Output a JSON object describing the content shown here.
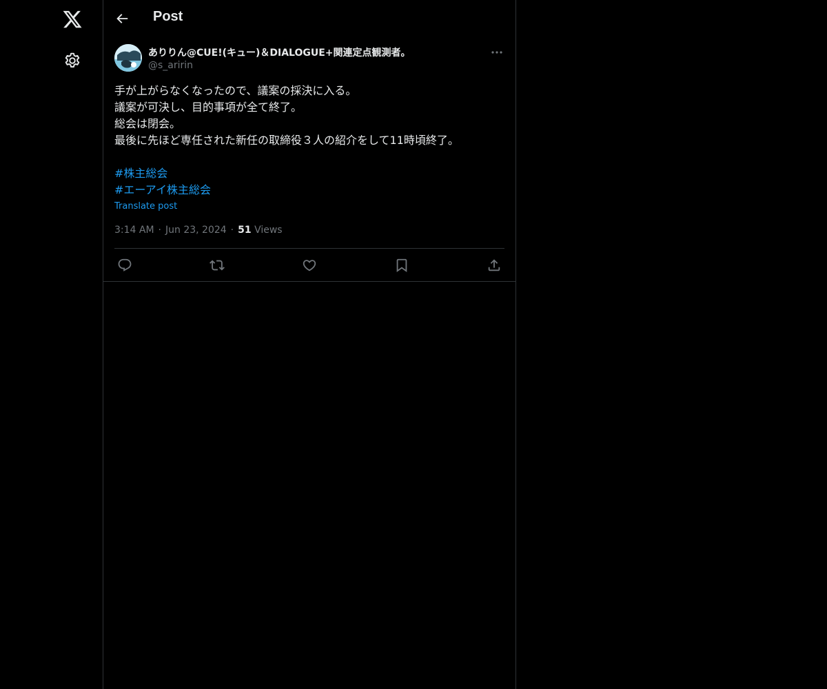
{
  "nav": {
    "logo_icon": "x-logo-icon",
    "settings_icon": "gear-icon"
  },
  "header": {
    "title": "Post",
    "back_icon": "arrow-left-icon"
  },
  "post": {
    "display_name": "ありりん@CUE!(キュー)＆DIALOGUE+関連定点観測者。",
    "handle": "@s_aririn",
    "text_lines": [
      "手が上がらなくなったので、議案の採決に入る。",
      "議案が可決し、目的事項が全て終了。",
      "総会は閉会。",
      "最後に先ほど専任された新任の取締役３人の紹介をして11時頃終了。"
    ],
    "hashtags": [
      "#株主総会",
      "#エーアイ株主総会"
    ],
    "translate_label": "Translate post",
    "time": "3:14 AM",
    "date": "Jun 23, 2024",
    "views_count": "51",
    "views_label": "Views"
  },
  "colors": {
    "background": "#000000",
    "text": "#e7e9ea",
    "secondary": "#71767b",
    "accent": "#1d9bf0",
    "border": "#2f3336"
  }
}
